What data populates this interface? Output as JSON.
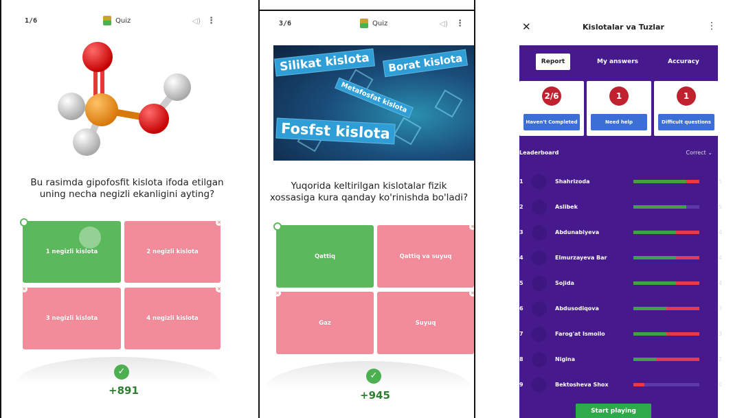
{
  "panel1": {
    "counter": "1/6",
    "mode_label": "Quiz",
    "question": "Bu rasimda gipofosfit kislota ifoda etilgan uning necha negizli ekanligini ayting?",
    "options": [
      "1 negizli kislota",
      "2 negizli kislota",
      "3 negizli kislota",
      "4 negizli kislota"
    ],
    "score": "+891",
    "icons": [
      "quiz-icon",
      "sound-icon",
      "more-icon",
      "check-icon"
    ]
  },
  "panel2": {
    "counter": "3/6",
    "mode_label": "Quiz",
    "banner_tags": [
      "Silikat kislota",
      "Borat kislota",
      "Metafosfat kislota",
      "Fosfst kislota"
    ],
    "question": "Yuqorida keltirilgan kislotalar fizik xossasiga kura qanday ko'rinishda bo'ladi?",
    "options": [
      "Qattiq",
      "Qattiq va suyuq",
      "Gaz",
      "Suyuq"
    ],
    "score": "+945"
  },
  "panel3": {
    "title": "Kislotalar va Tuzlar",
    "tabs": [
      "Report",
      "My answers",
      "Accuracy"
    ],
    "cards": [
      {
        "value": "2/6",
        "label": "Haven't Completed"
      },
      {
        "value": "1",
        "label": "Need help"
      },
      {
        "value": "1",
        "label": "Difficult questions"
      }
    ],
    "leaderboard_label": "Leaderboard",
    "sort_label": "Correct",
    "rows": [
      {
        "rank": "1",
        "name": "Shahrizoda",
        "score": "5",
        "correct": 0.8,
        "wrong": 0.2
      },
      {
        "rank": "2",
        "name": "Aslibek",
        "score": "5",
        "correct": 0.8,
        "wrong": 0.0
      },
      {
        "rank": "3",
        "name": "Abdunabiyeva",
        "score": "4",
        "correct": 0.65,
        "wrong": 0.35
      },
      {
        "rank": "4",
        "name": "Elmurzayeva Bar",
        "score": "4",
        "correct": 0.65,
        "wrong": 0.35
      },
      {
        "rank": "5",
        "name": "Sojida",
        "score": "4",
        "correct": 0.65,
        "wrong": 0.35
      },
      {
        "rank": "6",
        "name": "Abdusodiqova",
        "score": "3",
        "correct": 0.5,
        "wrong": 0.5
      },
      {
        "rank": "7",
        "name": "Farog'at Ismoilo",
        "score": "3",
        "correct": 0.5,
        "wrong": 0.5
      },
      {
        "rank": "8",
        "name": "Nigina",
        "score": "2",
        "correct": 0.35,
        "wrong": 0.65
      },
      {
        "rank": "9",
        "name": "Bektosheva Shox",
        "score": "0",
        "correct": 0.0,
        "wrong": 0.17
      }
    ],
    "start_button": "Start playing"
  },
  "colors": {
    "correct_green": "#5cb85c",
    "wrong_pink": "#f28b9a",
    "report_purple": "#461a8c",
    "badge_red": "#c0212f",
    "score_green": "#2e7d32"
  }
}
